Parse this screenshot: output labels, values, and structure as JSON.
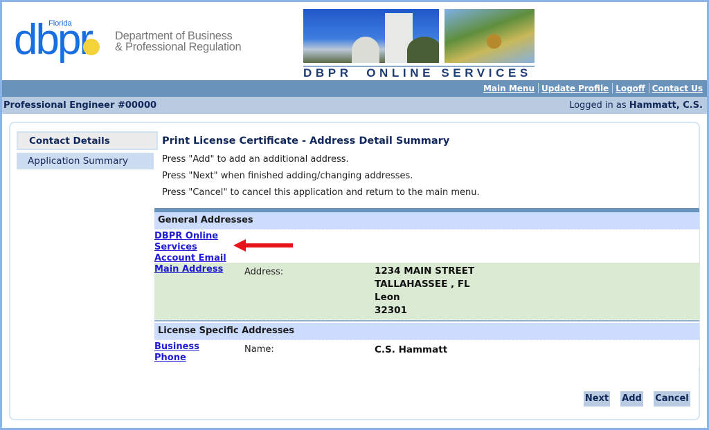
{
  "header": {
    "logo": {
      "state": "Florida",
      "mark": "dbpr",
      "department_line1": "Department of Business",
      "department_line2": "& Professional Regulation"
    },
    "banner_title": "DBPR  ONLINE SERVICES"
  },
  "nav": {
    "links": [
      {
        "label": "Main Menu"
      },
      {
        "label": "Update Profile"
      },
      {
        "label": "Logoff"
      },
      {
        "label": "Contact Us"
      }
    ]
  },
  "subbar": {
    "license": "Professional Engineer #00000",
    "logged_in_prefix": "Logged in as ",
    "user_name": "Hammatt, C.S."
  },
  "sidebar": {
    "items": [
      {
        "label": "Contact Details",
        "active": true
      },
      {
        "label": "Application Summary",
        "active": false
      }
    ]
  },
  "main": {
    "title": "Print License Certificate - Address Detail Summary",
    "instructions": [
      "Press \"Add\" to add an additional address.",
      "Press \"Next\" when finished adding/changing addresses.",
      "Press \"Cancel\" to cancel this application and return to the main menu."
    ]
  },
  "general_addresses": {
    "header": "General Addresses",
    "rows": [
      {
        "link_label": "DBPR Online Services Account Email"
      },
      {
        "link_label": "Main Address",
        "field_label": "Address:",
        "values": [
          "1234 MAIN STREET",
          "TALLAHASSEE , FL",
          "Leon",
          "32301"
        ]
      }
    ]
  },
  "license_addresses": {
    "header": "License Specific Addresses",
    "rows": [
      {
        "link_label": "Business Phone",
        "field_label": "Name:",
        "value": "C.S. Hammatt"
      }
    ]
  },
  "annotation": {
    "arrow_icon": "red-arrow-left-icon",
    "color": "#e8141b"
  },
  "buttons": {
    "next": "Next",
    "add": "Add",
    "cancel": "Cancel"
  },
  "colors": {
    "frame": "#8ab4e8",
    "navbar": "#6a93bc",
    "subbar": "#b8cbe1",
    "section_header": "#cbdcfd",
    "highlight_row": "#dbead2",
    "link": "#1f1bd6",
    "heading": "#12275a"
  }
}
